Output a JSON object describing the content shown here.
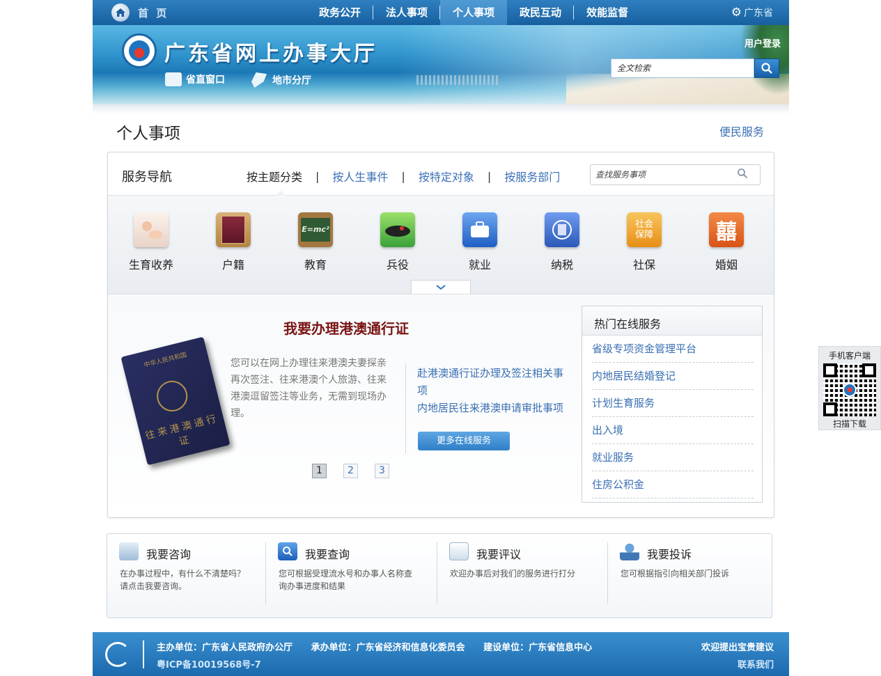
{
  "topnav": {
    "home": "首 页",
    "items": [
      "政务公开",
      "法人事项",
      "个人事项",
      "政民互动",
      "效能监督"
    ],
    "active_index": 2,
    "province": "广东省"
  },
  "banner": {
    "title": "广东省网上办事大厅",
    "links": [
      "省直窗口",
      "地市分厅"
    ],
    "login": "用户登录",
    "search_placeholder": "全文检索"
  },
  "page": {
    "title": "个人事项",
    "convenient": "便民服务"
  },
  "service_nav": {
    "title": "服务导航",
    "tabs": [
      "按主题分类",
      "按人生事件",
      "按特定对象",
      "按服务部门"
    ],
    "active_tab": 0,
    "search_placeholder": "查找服务事项",
    "categories": [
      {
        "label": "生育收养",
        "icon": "baby-icon",
        "color": "#f3e6df"
      },
      {
        "label": "户籍",
        "icon": "household-book-icon",
        "color": "#7b2436"
      },
      {
        "label": "教育",
        "icon": "chalkboard-icon",
        "color": "#3f6b3a"
      },
      {
        "label": "兵役",
        "icon": "military-beret-icon",
        "color": "#3fa33a"
      },
      {
        "label": "就业",
        "icon": "briefcase-icon",
        "color": "#2f6fd0"
      },
      {
        "label": "纳税",
        "icon": "tax-emblem-icon",
        "color": "#3a6dc8"
      },
      {
        "label": "社保",
        "icon": "social-security-icon",
        "color": "#f0a12a",
        "text": "社会\n保障"
      },
      {
        "label": "婚姻",
        "icon": "double-happiness-icon",
        "color": "#e06a2a",
        "text": "囍"
      }
    ]
  },
  "feature": {
    "title": "我要办理港澳通行证",
    "passport_header": "中华人民共和国",
    "passport_text": "往来港澳通行证",
    "description": "您可以在网上办理往来港澳夫妻探亲再次签注、往来港澳个人旅游、往来港澳逗留签注等业务，无需到现场办理。",
    "links": [
      "赴港澳通行证办理及签注相关事项",
      "内地居民往来港澳申请审批事项"
    ],
    "more_button": "更多在线服务",
    "pages": [
      "1",
      "2",
      "3"
    ],
    "active_page": 0
  },
  "hot_services": {
    "title": "热门在线服务",
    "items": [
      "省级专项资金管理平台",
      "内地居民结婚登记",
      "计划生育服务",
      "出入境",
      "就业服务",
      "住房公积金"
    ]
  },
  "actions": [
    {
      "title": "我要咨询",
      "icon": "consult-icon",
      "desc": "在办事过程中，有什么不清楚吗？请点击我要咨询。"
    },
    {
      "title": "我要查询",
      "icon": "search-magnifier-icon",
      "desc": "您可根据受理流水号和办事人名称查询办事进度和结果"
    },
    {
      "title": "我要评议",
      "icon": "envelope-icon",
      "desc": "欢迎办事后对我们的服务进行打分"
    },
    {
      "title": "我要投诉",
      "icon": "person-icon",
      "desc": "您可根据指引向相关部门投诉"
    }
  ],
  "footer": {
    "host": "主办单位：广东省人民政府办公厅",
    "undertake": "承办单位：广东省经济和信息化委员会",
    "build": "建设单位：广东省信息中心",
    "icp": "粤ICP备10019568号-7",
    "suggest": "欢迎提出宝贵建议",
    "contact": "联系我们"
  },
  "qr": {
    "top": "手机客户端",
    "bottom": "扫描下载"
  }
}
